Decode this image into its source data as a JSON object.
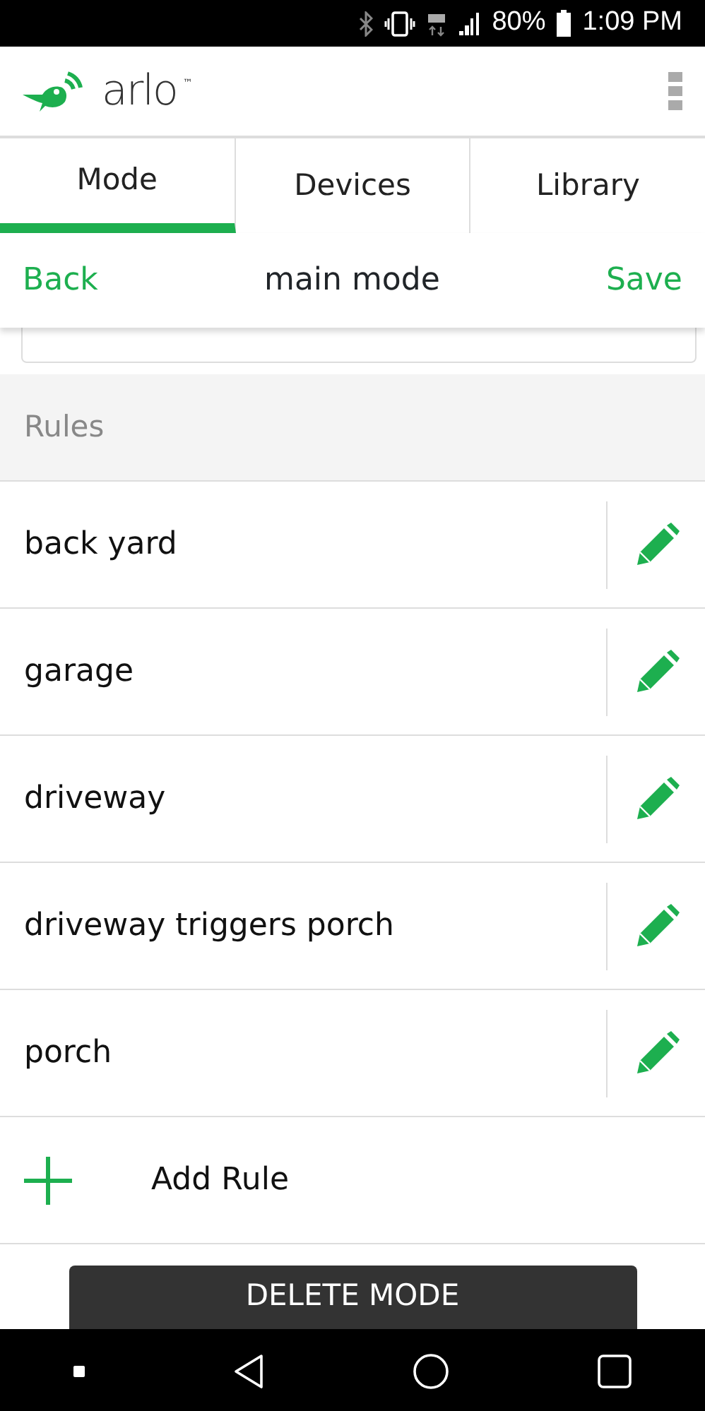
{
  "status_bar": {
    "battery": "80%",
    "time": "1:09 PM"
  },
  "header": {
    "logo": "arlo",
    "trademark": "™"
  },
  "tabs": [
    {
      "label": "Mode",
      "selected": true
    },
    {
      "label": "Devices",
      "selected": false
    },
    {
      "label": "Library",
      "selected": false
    }
  ],
  "subheader": {
    "back": "Back",
    "title": "main mode",
    "save": "Save"
  },
  "rules": {
    "title": "Rules",
    "items": [
      {
        "name": "back yard"
      },
      {
        "name": "garage"
      },
      {
        "name": "driveway"
      },
      {
        "name": "driveway triggers porch"
      },
      {
        "name": "porch"
      }
    ],
    "add": "Add Rule"
  },
  "delete_button": "DELETE MODE"
}
